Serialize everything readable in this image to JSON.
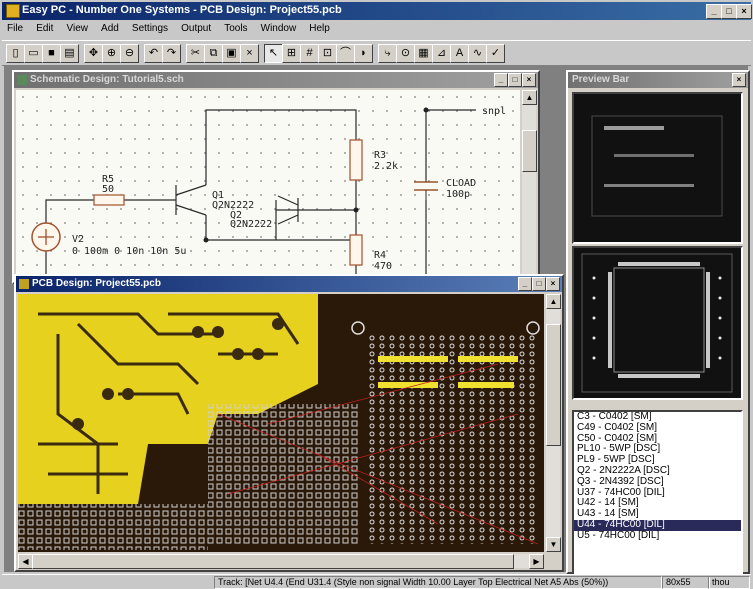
{
  "app": {
    "title": "Easy PC - Number One Systems - PCB Design: Project55.pcb"
  },
  "menu": [
    "File",
    "Edit",
    "View",
    "Add",
    "Settings",
    "Output",
    "Tools",
    "Window",
    "Help"
  ],
  "schematic_window": {
    "title": "Schematic Design: Tutorial5.sch",
    "labels": {
      "r5_name": "R5",
      "r5_value": "50",
      "q1_name": "Q1",
      "q1_part": "Q2N2222",
      "q2_name": "Q2",
      "q2_part": "Q2N2222",
      "r3_name": "R3",
      "r3_value": "2.2k",
      "cload_name": "CLOAD",
      "cload_value": "100p",
      "v2_name": "V2",
      "v2_params": "0 100m 0 10n 10n 5u",
      "r4_name": "R4",
      "r4_value": "470",
      "edge_label": "snpl"
    }
  },
  "pcb_window": {
    "title": "PCB Design: Project55.pcb"
  },
  "preview_window": {
    "title": "Preview Bar"
  },
  "component_list": [
    "C3 - C0402 [SM]",
    "C49 - C0402 [SM]",
    "C50 - C0402 [SM]",
    "PL10 - 5WP [DSC]",
    "PL9 - 5WP [DSC]",
    "Q2 - 2N2222A [DSC]",
    "Q3 - 2N4392 [DSC]",
    "U37 - 74HC00 [DIL]",
    "U42 - 14 [SM]",
    "U43 - 14 [SM]",
    "U44 - 74HC00 [DIL]",
    "U5 - 74HC00 [DIL]"
  ],
  "selected_index": 10,
  "status": {
    "track": "Track: [Net U4.4 (End U31.4 (Style non signal Width 10.00 Layer Top Electrical Net A5 Abs (50%))",
    "coords": "80x55",
    "units": "thou"
  }
}
